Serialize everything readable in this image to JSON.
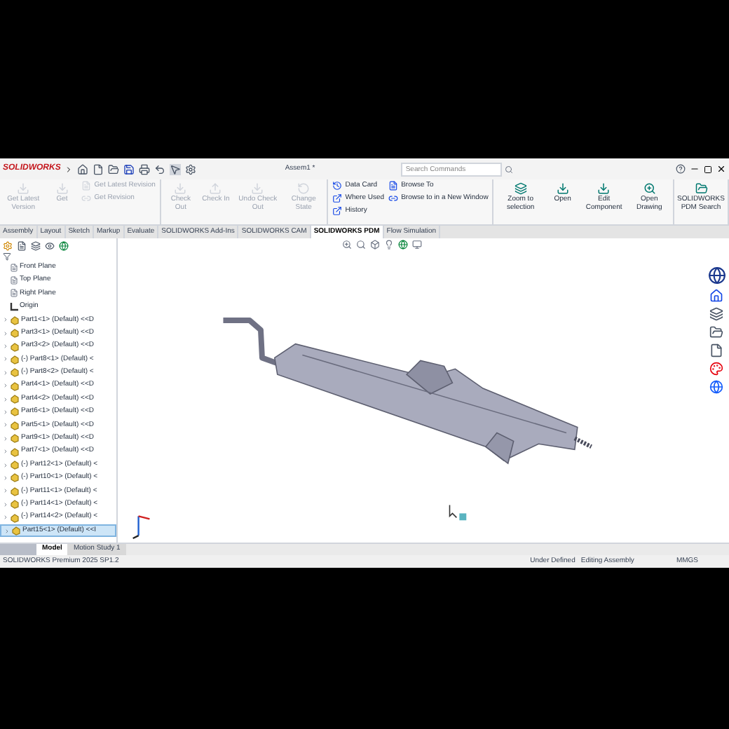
{
  "title_bar": {
    "logo": "SOLIDWORKS",
    "document": "Assem1 *",
    "search": {
      "placeholder": "Search Commands"
    }
  },
  "ribbon": {
    "groups": [
      [
        {
          "kind": "large",
          "label": "Get Latest Version",
          "disabled": true
        },
        {
          "kind": "large",
          "label": "Get",
          "disabled": true
        },
        {
          "kind": "stack",
          "items": [
            {
              "label": "Get Latest Revision",
              "disabled": true
            },
            {
              "label": "Get Revision",
              "disabled": true
            }
          ]
        }
      ],
      [
        {
          "kind": "large",
          "label": "Check Out",
          "disabled": true
        },
        {
          "kind": "large",
          "label": "Check In",
          "disabled": true
        },
        {
          "kind": "large",
          "label": "Undo Check Out",
          "disabled": true
        },
        {
          "kind": "large",
          "label": "Change State",
          "disabled": true
        }
      ],
      [
        {
          "kind": "stack",
          "items": [
            {
              "label": "Data Card",
              "disabled": false
            },
            {
              "label": "Where Used",
              "disabled": false
            },
            {
              "label": "History",
              "disabled": false
            }
          ]
        },
        {
          "kind": "stack",
          "items": [
            {
              "label": "Browse To",
              "disabled": false
            },
            {
              "label": "Browse to in a New Window",
              "disabled": false
            }
          ]
        }
      ],
      [
        {
          "kind": "large",
          "label": "Zoom to selection",
          "disabled": false
        },
        {
          "kind": "large",
          "label": "Open",
          "disabled": false
        },
        {
          "kind": "large",
          "label": "Edit Component",
          "disabled": false
        },
        {
          "kind": "large",
          "label": "Open Drawing",
          "disabled": false
        }
      ],
      [
        {
          "kind": "large",
          "label": "SOLIDWORKS PDM Search",
          "disabled": false
        }
      ]
    ]
  },
  "tabs": [
    {
      "label": "Assembly",
      "selected": false
    },
    {
      "label": "Layout",
      "selected": false
    },
    {
      "label": "Sketch",
      "selected": false
    },
    {
      "label": "Markup",
      "selected": false
    },
    {
      "label": "Evaluate",
      "selected": false
    },
    {
      "label": "SOLIDWORKS Add-Ins",
      "selected": false
    },
    {
      "label": "SOLIDWORKS CAM",
      "selected": false
    },
    {
      "label": "SOLIDWORKS PDM",
      "selected": true
    },
    {
      "label": "Flow Simulation",
      "selected": false
    }
  ],
  "tree": {
    "items": [
      {
        "kind": "plane",
        "label": "Front Plane",
        "selected": false
      },
      {
        "kind": "plane",
        "label": "Top Plane",
        "selected": false
      },
      {
        "kind": "plane",
        "label": "Right Plane",
        "selected": false
      },
      {
        "kind": "origin",
        "label": "Origin",
        "selected": false
      },
      {
        "kind": "part",
        "label": "Part1<1> (Default) <<D",
        "selected": false
      },
      {
        "kind": "part",
        "label": "Part3<1> (Default) <<D",
        "selected": false
      },
      {
        "kind": "part",
        "label": "Part3<2> (Default) <<D",
        "selected": false
      },
      {
        "kind": "part",
        "label": "(-) Part8<1> (Default) <",
        "selected": false
      },
      {
        "kind": "part",
        "label": "(-) Part8<2> (Default) <",
        "selected": false
      },
      {
        "kind": "part",
        "label": "Part4<1> (Default) <<D",
        "selected": false
      },
      {
        "kind": "part",
        "label": "Part4<2> (Default) <<D",
        "selected": false
      },
      {
        "kind": "part",
        "label": "Part6<1> (Default) <<D",
        "selected": false
      },
      {
        "kind": "part",
        "label": "Part5<1> (Default) <<D",
        "selected": false
      },
      {
        "kind": "part",
        "label": "Part9<1> (Default) <<D",
        "selected": false
      },
      {
        "kind": "part",
        "label": "Part7<1> (Default) <<D",
        "selected": false
      },
      {
        "kind": "part",
        "label": "(-) Part12<1> (Default) <",
        "selected": false
      },
      {
        "kind": "part",
        "label": "(-) Part10<1> (Default) <",
        "selected": false
      },
      {
        "kind": "part",
        "label": "(-) Part11<1> (Default) <",
        "selected": false
      },
      {
        "kind": "part",
        "label": "(-) Part14<1> (Default) <",
        "selected": false
      },
      {
        "kind": "part",
        "label": "(-) Part14<2> (Default) <",
        "selected": false
      },
      {
        "kind": "part",
        "label": "Part15<1> (Default) <<I",
        "selected": true
      }
    ]
  },
  "bottom_tabs": [
    {
      "label": "Model",
      "selected": true
    },
    {
      "label": "Motion Study 1",
      "selected": false
    }
  ],
  "status_bar": {
    "product": "SOLIDWORKS Premium 2025 SP1.2",
    "state": "Under Defined",
    "mode": "Editing Assembly",
    "units": "MMGS"
  }
}
